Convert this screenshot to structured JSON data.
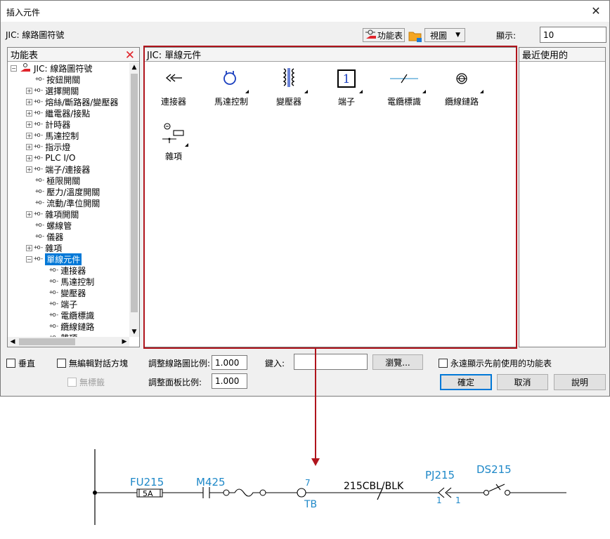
{
  "dialog": {
    "title": "插入元件",
    "path_label": "JIC: 線路圖符號",
    "toolbar": {
      "menu_button": "功能表",
      "view_button": "視圖",
      "display_label": "顯示:",
      "display_value": "10"
    },
    "left_panel": {
      "header": "功能表",
      "tree": [
        {
          "label": "JIC: 線路圖符號",
          "level": 0,
          "expand": "minus",
          "conn": false,
          "icon": true
        },
        {
          "label": "按鈕開關",
          "level": 1,
          "expand": "none"
        },
        {
          "label": "選擇開關",
          "level": 1,
          "expand": "plus"
        },
        {
          "label": "熔絲/斷路器/變壓器",
          "level": 1,
          "expand": "plus"
        },
        {
          "label": "繼電器/接點",
          "level": 1,
          "expand": "plus"
        },
        {
          "label": "計時器",
          "level": 1,
          "expand": "plus"
        },
        {
          "label": "馬達控制",
          "level": 1,
          "expand": "plus"
        },
        {
          "label": "指示燈",
          "level": 1,
          "expand": "plus"
        },
        {
          "label": "PLC I/O",
          "level": 1,
          "expand": "plus"
        },
        {
          "label": "端子/連接器",
          "level": 1,
          "expand": "plus"
        },
        {
          "label": "極限開關",
          "level": 1,
          "expand": "none"
        },
        {
          "label": "壓力/溫度開關",
          "level": 1,
          "expand": "none"
        },
        {
          "label": "流動/準位開關",
          "level": 1,
          "expand": "none"
        },
        {
          "label": "雜項開關",
          "level": 1,
          "expand": "plus"
        },
        {
          "label": "螺線管",
          "level": 1,
          "expand": "none"
        },
        {
          "label": "儀器",
          "level": 1,
          "expand": "none"
        },
        {
          "label": "雜項",
          "level": 1,
          "expand": "plus"
        },
        {
          "label": "單線元件",
          "level": 1,
          "expand": "minus",
          "selected": true
        },
        {
          "label": "連接器",
          "level": 2,
          "expand": "none"
        },
        {
          "label": "馬達控制",
          "level": 2,
          "expand": "none"
        },
        {
          "label": "變壓器",
          "level": 2,
          "expand": "none"
        },
        {
          "label": "端子",
          "level": 2,
          "expand": "none"
        },
        {
          "label": "電纜標識",
          "level": 2,
          "expand": "none"
        },
        {
          "label": "纜線鏈路",
          "level": 2,
          "expand": "none"
        },
        {
          "label": "雜項",
          "level": 2,
          "expand": "none"
        }
      ]
    },
    "center_panel": {
      "header": "JIC: 單線元件",
      "items": [
        {
          "label": "連接器",
          "icon": "connector-icon"
        },
        {
          "label": "馬達控制",
          "icon": "motor-control-icon"
        },
        {
          "label": "變壓器",
          "icon": "transformer-icon"
        },
        {
          "label": "端子",
          "icon": "terminal-icon"
        },
        {
          "label": "電纜標識",
          "icon": "cable-marker-icon"
        },
        {
          "label": "纜線鏈路",
          "icon": "cable-link-icon"
        },
        {
          "label": "雜項",
          "icon": "misc-icon"
        }
      ]
    },
    "right_panel": {
      "header": "最近使用的"
    },
    "bottom": {
      "vertical": "垂直",
      "no_edit_dialog": "無編輯對話方塊",
      "no_tag": "無標籤",
      "schematic_scale_label": "調整線路圖比例:",
      "schematic_scale_value": "1.000",
      "panel_scale_label": "調整面板比例:",
      "panel_scale_value": "1.000",
      "type_it_label": "鍵入:",
      "type_it_value": "",
      "browse_button": "瀏覽...",
      "always_show_label": "永遠顯示先前使用的功能表",
      "ok_button": "確定",
      "cancel_button": "取消",
      "help_button": "說明"
    }
  },
  "diagram": {
    "fuse_tag": "FU215",
    "fuse_rating": "5A",
    "motor_tag": "M425",
    "terminal_number": "7",
    "terminal_tag": "TB",
    "cable_label": "215CBL/BLK",
    "connector_tag": "PJ215",
    "connector_pin_left": "1",
    "connector_pin_right": "1",
    "switch_tag": "DS215"
  },
  "colors": {
    "accent": "#0078d7",
    "highlight_border": "#b0141c",
    "diagram_blue": "#1e88c8",
    "delete_red": "#e0242b"
  }
}
